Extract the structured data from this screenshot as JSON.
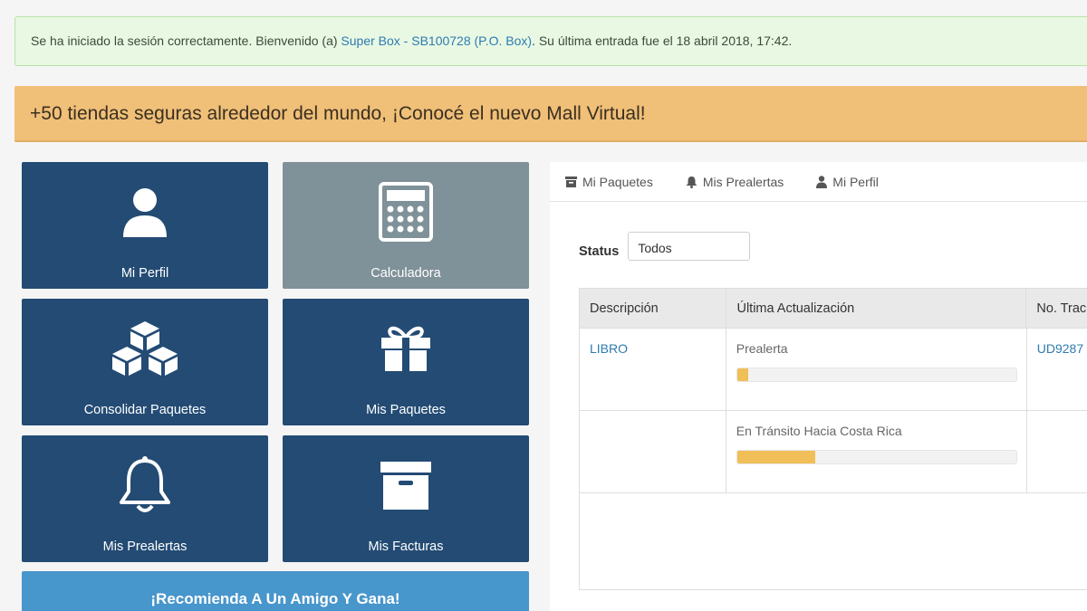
{
  "alert": {
    "prefix": "Se ha iniciado la sesión correctamente. Bienvenido (a) ",
    "user_link": "Super Box - SB100728 (P.O. Box)",
    "suffix": ". Su última entrada fue el 18 abril 2018, 17:42."
  },
  "promo": {
    "text": "+50 tiendas seguras alrededor del mundo, ¡Conocé el nuevo Mall Virtual!"
  },
  "tiles": [
    {
      "label": "Mi Perfil",
      "icon": "user-icon"
    },
    {
      "label": "Calculadora",
      "icon": "calculator-icon"
    },
    {
      "label": "Consolidar Paquetes",
      "icon": "cubes-icon"
    },
    {
      "label": "Mis Paquetes",
      "icon": "gift-icon"
    },
    {
      "label": "Mis Prealertas",
      "icon": "bell-icon"
    },
    {
      "label": "Mis Facturas",
      "icon": "archive-icon"
    }
  ],
  "cta": {
    "label": "¡Recomienda A Un Amigo Y Gana!"
  },
  "tabs": [
    {
      "label": "Mi Paquetes",
      "icon": "box-icon"
    },
    {
      "label": "Mis Prealertas",
      "icon": "bell-icon"
    },
    {
      "label": "Mi Perfil",
      "icon": "user-icon"
    }
  ],
  "status": {
    "label": "Status",
    "selected": "Todos"
  },
  "table": {
    "headers": [
      "Descripción",
      "Última Actualización",
      "No. Trac"
    ],
    "rows": [
      {
        "description": "LIBRO",
        "update": "Prealerta",
        "progress": 0.04,
        "tracking": "UD9287"
      },
      {
        "description": "",
        "update": "En Tránsito Hacia Costa Rica",
        "progress": 0.28,
        "tracking": ""
      }
    ]
  },
  "colors": {
    "tile": "#234b74",
    "tile_gray": "#7f9199",
    "promo": "#f0bf78",
    "cta": "#4796cc",
    "progress": "#f0bf58"
  }
}
